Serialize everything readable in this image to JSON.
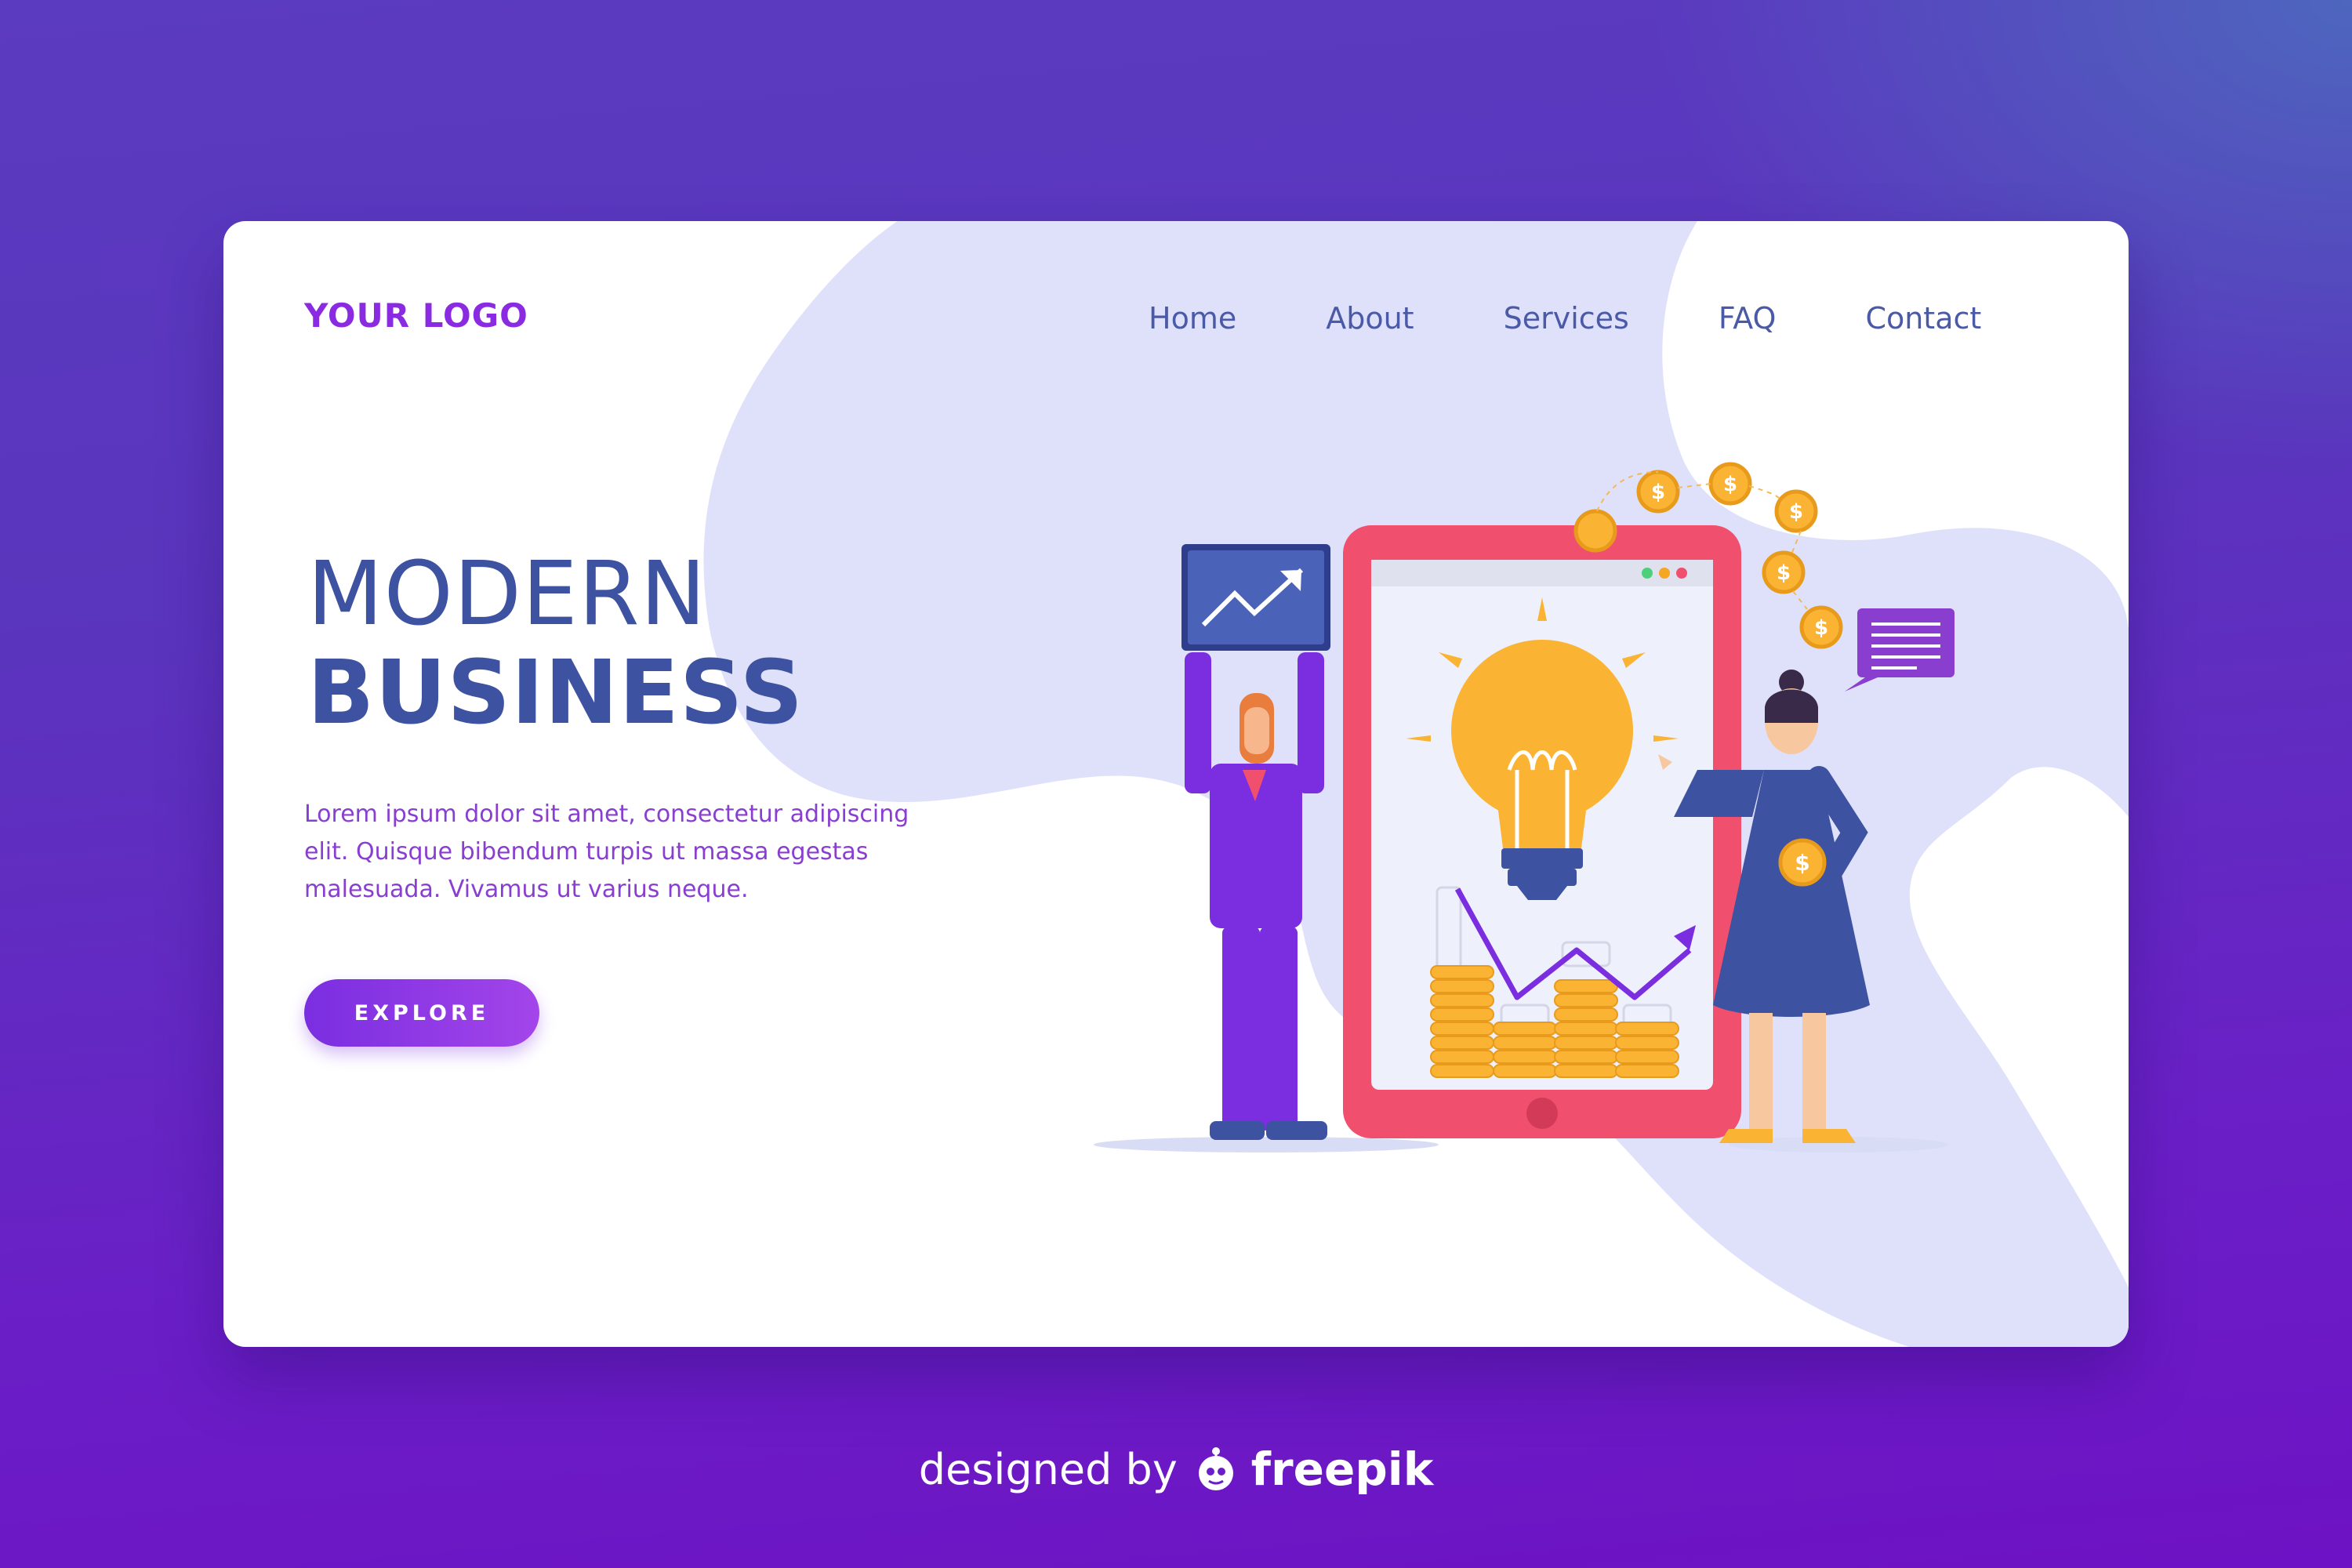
{
  "brand": {
    "logo_text": "YOUR LOGO",
    "accent_color": "#8a2be2",
    "title_color": "#3d52a0"
  },
  "nav": {
    "items": [
      {
        "label": "Home"
      },
      {
        "label": "About"
      },
      {
        "label": "Services"
      },
      {
        "label": "FAQ"
      },
      {
        "label": "Contact"
      }
    ]
  },
  "hero": {
    "title_line1": "MODERN",
    "title_line2": "BUSINESS",
    "description": "Lorem ipsum dolor sit amet, consectetur adipiscing elit. Quisque bibendum turpis ut massa egestas malesuada. Vivamus ut varius neque.",
    "cta_label": "EXPLORE"
  },
  "illustration": {
    "icons": [
      "chart-board-icon",
      "tablet-icon",
      "lightbulb-icon",
      "coin-icon",
      "chat-bubble-icon",
      "man-figure",
      "woman-figure",
      "coin-stack-chart"
    ],
    "coin_symbol": "$"
  },
  "footer": {
    "prefix": "designed by",
    "brand": "freepik"
  }
}
